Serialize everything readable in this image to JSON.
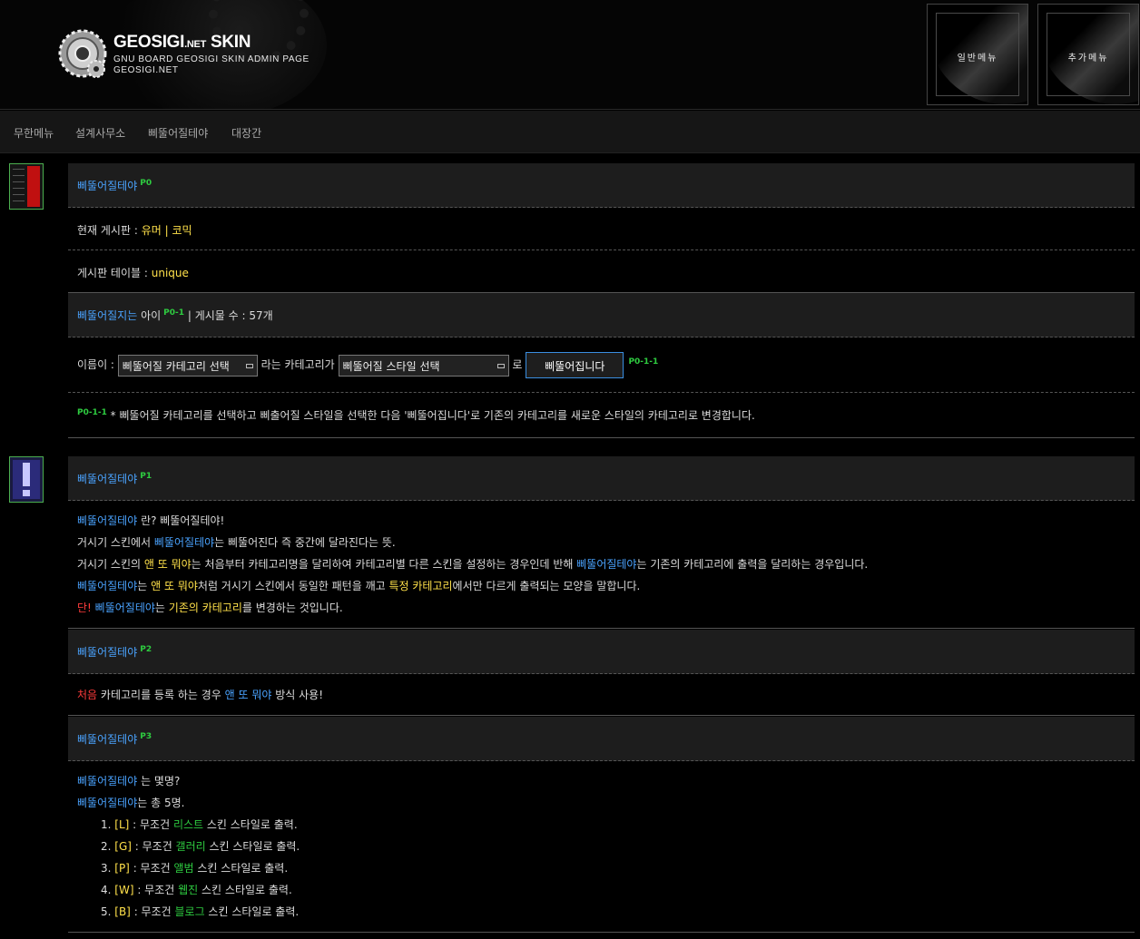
{
  "header": {
    "brand_title": "GEOSIGI",
    "brand_net": ".NET",
    "brand_skin": "SKIN",
    "brand_sub": "GNU BOARD GEOSIGI SKIN ADMIN PAGE",
    "brand_site": "GEOSIGI.NET",
    "menu_general": "일반메뉴",
    "menu_extra": "추가메뉴"
  },
  "nav": [
    "무한메뉴",
    "설계사무소",
    "삐뚤어질테야",
    "대장간"
  ],
  "p0": {
    "title": "삐뚤어질테야",
    "badge": "P0",
    "board_label": "현재 게시판 : ",
    "board_value": "유머 | 코믹",
    "table_label": "게시판 테이블 : ",
    "table_value": "unique",
    "sub_title": "삐뚤어질지는",
    "sub_title_rest": " 아이",
    "sub_badge": "P0-1",
    "sub_count": " | 게시물 수 : 57개",
    "name_label": "이름이 : ",
    "category_select": "삐뚤어질 카테고리 선택",
    "mid_label": " 라는 카테고리가 ",
    "style_select": "삐뚤어질 스타일 선택",
    "to_label": " 로 ",
    "submit_label": "삐뚤어집니다",
    "form_badge": "P0-1-1",
    "help_badge": "P0-1-1",
    "help_text": " * 삐뚤어질 카테고리를 선택하고 삐출어질 스타일을 선택한 다음 '삐뚤어집니다'로 기존의 카테고리를 새로운 스타일의 카테고리로 변경합니다."
  },
  "p1": {
    "title": "삐뚤어질테야",
    "badge": "P1",
    "l1_a": "삐뚤어질테야",
    "l1_b": " 란? 삐뚤어질테야!",
    "l2_a": "거시기 스킨에서 ",
    "l2_b": "삐뚤어질테야",
    "l2_c": "는 삐뚤어진다 즉 중간에 달라진다는 뜻.",
    "l3_a": "거시기 스킨의 ",
    "l3_b": "앤 또 뭐야",
    "l3_c": "는 처음부터 카테고리명을 달리하여 카테고리별 다른 스킨을 설정하는 경우인데 반해 ",
    "l3_d": "삐뚤어질테야",
    "l3_e": "는 기존의 카테고리에 출력을 달리하는 경우입니다.",
    "l4_a": "삐뚤어질테야",
    "l4_b": "는 ",
    "l4_c": "앤 또 뭐야",
    "l4_d": "처럼 거시기 스킨에서 동일한 패턴을 깨고 ",
    "l4_e": "특정 카테고리",
    "l4_f": "에서만 다르게 출력되는 모양을 말합니다.",
    "l5_a": "단!",
    "l5_b": " 삐뚤어질테야",
    "l5_c": "는 ",
    "l5_d": "기존의 카테고리",
    "l5_e": "를 변경하는 것입니다."
  },
  "p2": {
    "title": "삐뚤어질테야",
    "badge": "P2",
    "a": "처음",
    "b": " 카테고리를 등록 하는 경우 ",
    "c": "앤 또 뭐야",
    "d": " 방식 사용!"
  },
  "p3": {
    "title": "삐뚤어질테야",
    "badge": "P3",
    "l1_a": "삐뚤어질테야",
    "l1_b": " 는 몇명?",
    "l2_a": "삐뚤어질테야",
    "l2_b": "는 총 5명.",
    "items": [
      {
        "num": "1. ",
        "code": "[L]",
        "pre": " : 무조건 ",
        "name": "리스트",
        "post": " 스킨 스타일로 출력."
      },
      {
        "num": "2. ",
        "code": "[G]",
        "pre": " : 무조건 ",
        "name": "갤러리",
        "post": " 스킨 스타일로 출력."
      },
      {
        "num": "3. ",
        "code": "[P]",
        "pre": " : 무조건 ",
        "name": "앨범",
        "post": " 스킨 스타일로 출력."
      },
      {
        "num": "4. ",
        "code": "[W]",
        "pre": " : 무조건 ",
        "name": "웹진",
        "post": " 스킨 스타일로 출력."
      },
      {
        "num": "5. ",
        "code": "[B]",
        "pre": " : 무조건 ",
        "name": "블로그",
        "post": " 스킨 스타일로 출력."
      }
    ]
  },
  "colors": {
    "accent_blue": "#4aa3ff",
    "highlight_yellow": "#ffe14a",
    "badge_green": "#2ecc40",
    "warn_red": "#ff3b3b"
  }
}
